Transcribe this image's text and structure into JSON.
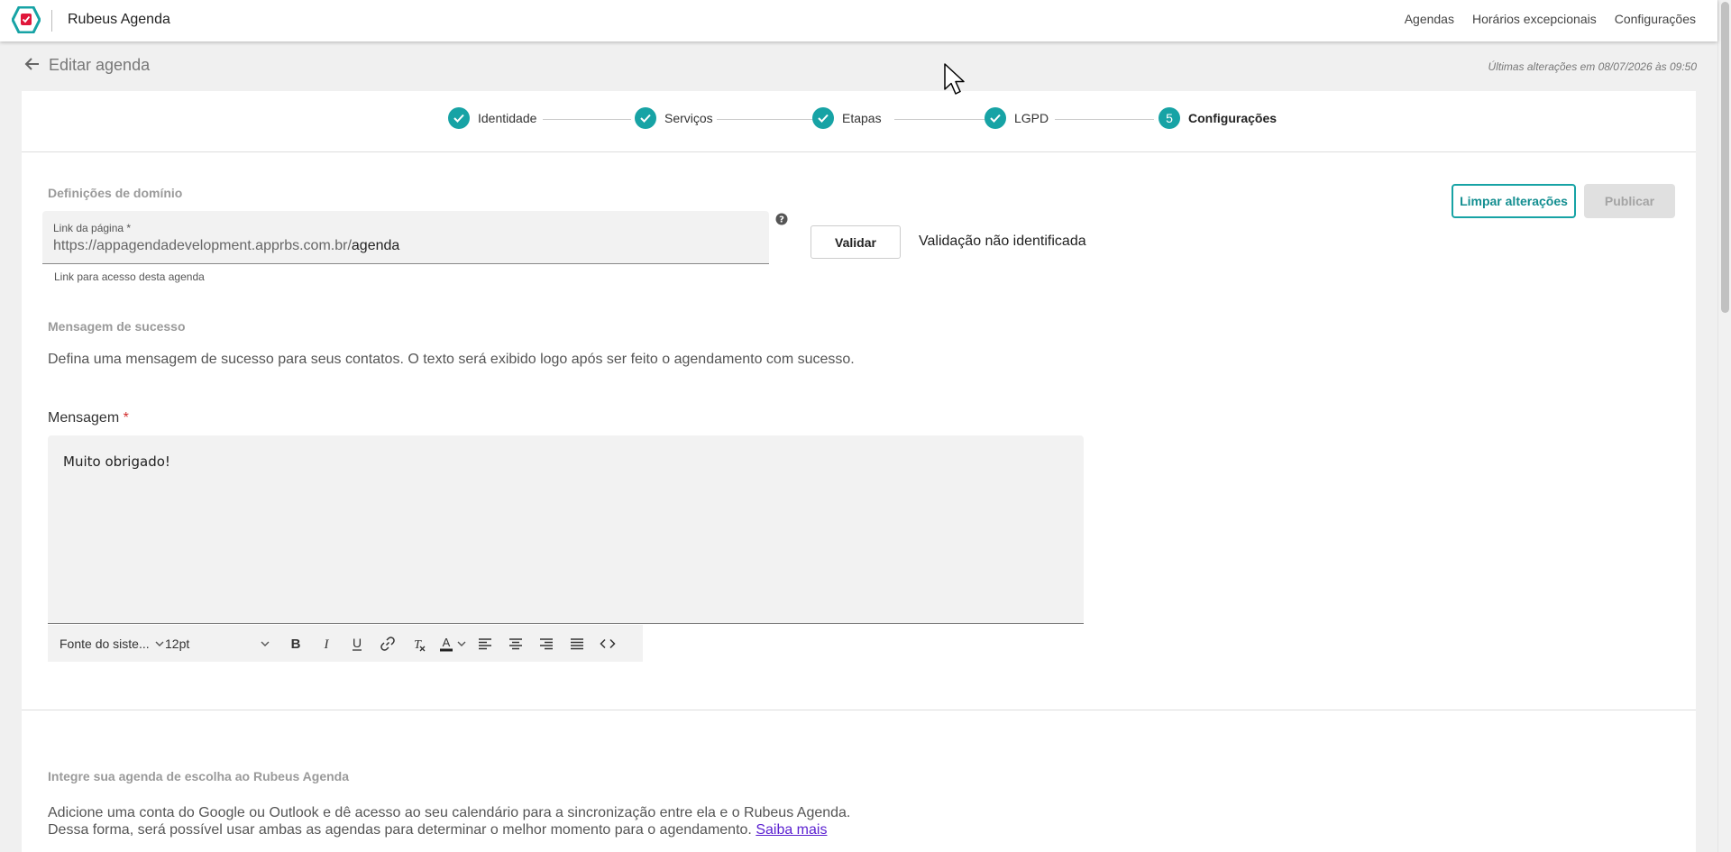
{
  "app": {
    "title": "Rubeus Agenda"
  },
  "nav": [
    "Agendas",
    "Horários excepcionais",
    "Configurações"
  ],
  "page": {
    "title": "Editar agenda",
    "last_change": "Últimas alterações em 08/07/2026 às 09:50"
  },
  "steps": [
    {
      "label": "Identidade",
      "state": "done"
    },
    {
      "label": "Serviços",
      "state": "done"
    },
    {
      "label": "Etapas",
      "state": "done"
    },
    {
      "label": "LGPD",
      "state": "done"
    },
    {
      "label": "Configurações",
      "state": "active",
      "number": "5"
    }
  ],
  "actions": {
    "clear": "Limpar alterações",
    "publish": "Publicar"
  },
  "domain": {
    "section_title": "Definições de domínio",
    "link_label": "Link da página *",
    "link_prefix": "https://appagendadevelopment.apprbs.com.br/",
    "link_value": "agenda",
    "hint": "Link para acesso desta agenda",
    "validate_label": "Validar",
    "validation_status": "Validação não identificada"
  },
  "success": {
    "section_title": "Mensagem de sucesso",
    "description": "Defina uma mensagem de sucesso para seus contatos. O texto será exibido logo após ser feito o agendamento com sucesso.",
    "message_label": "Mensagem",
    "required_mark": "*",
    "message_text": "Muito obrigado!"
  },
  "toolbar": {
    "font": "Fonte do siste...",
    "size": "12pt",
    "buttons": [
      "bold-icon",
      "italic-icon",
      "underline-icon",
      "link-icon",
      "clear-format-icon",
      "text-color-icon",
      "align-left-icon",
      "align-center-icon",
      "align-right-icon",
      "align-justify-icon",
      "code-icon"
    ]
  },
  "integration": {
    "section_title": "Integre sua agenda de escolha ao Rubeus Agenda",
    "line1": "Adicione uma conta do Google ou Outlook e dê acesso ao seu calendário para a sincronização entre ela e o Rubeus Agenda.",
    "line2": "Dessa forma, será possível usar ambas as agendas para determinar o melhor momento para o agendamento.",
    "link": "Saiba mais"
  },
  "colors": {
    "accent": "#17a3a5",
    "required": "#d32f2f",
    "link": "#5a1fd0",
    "logo_red": "#e0163a"
  }
}
